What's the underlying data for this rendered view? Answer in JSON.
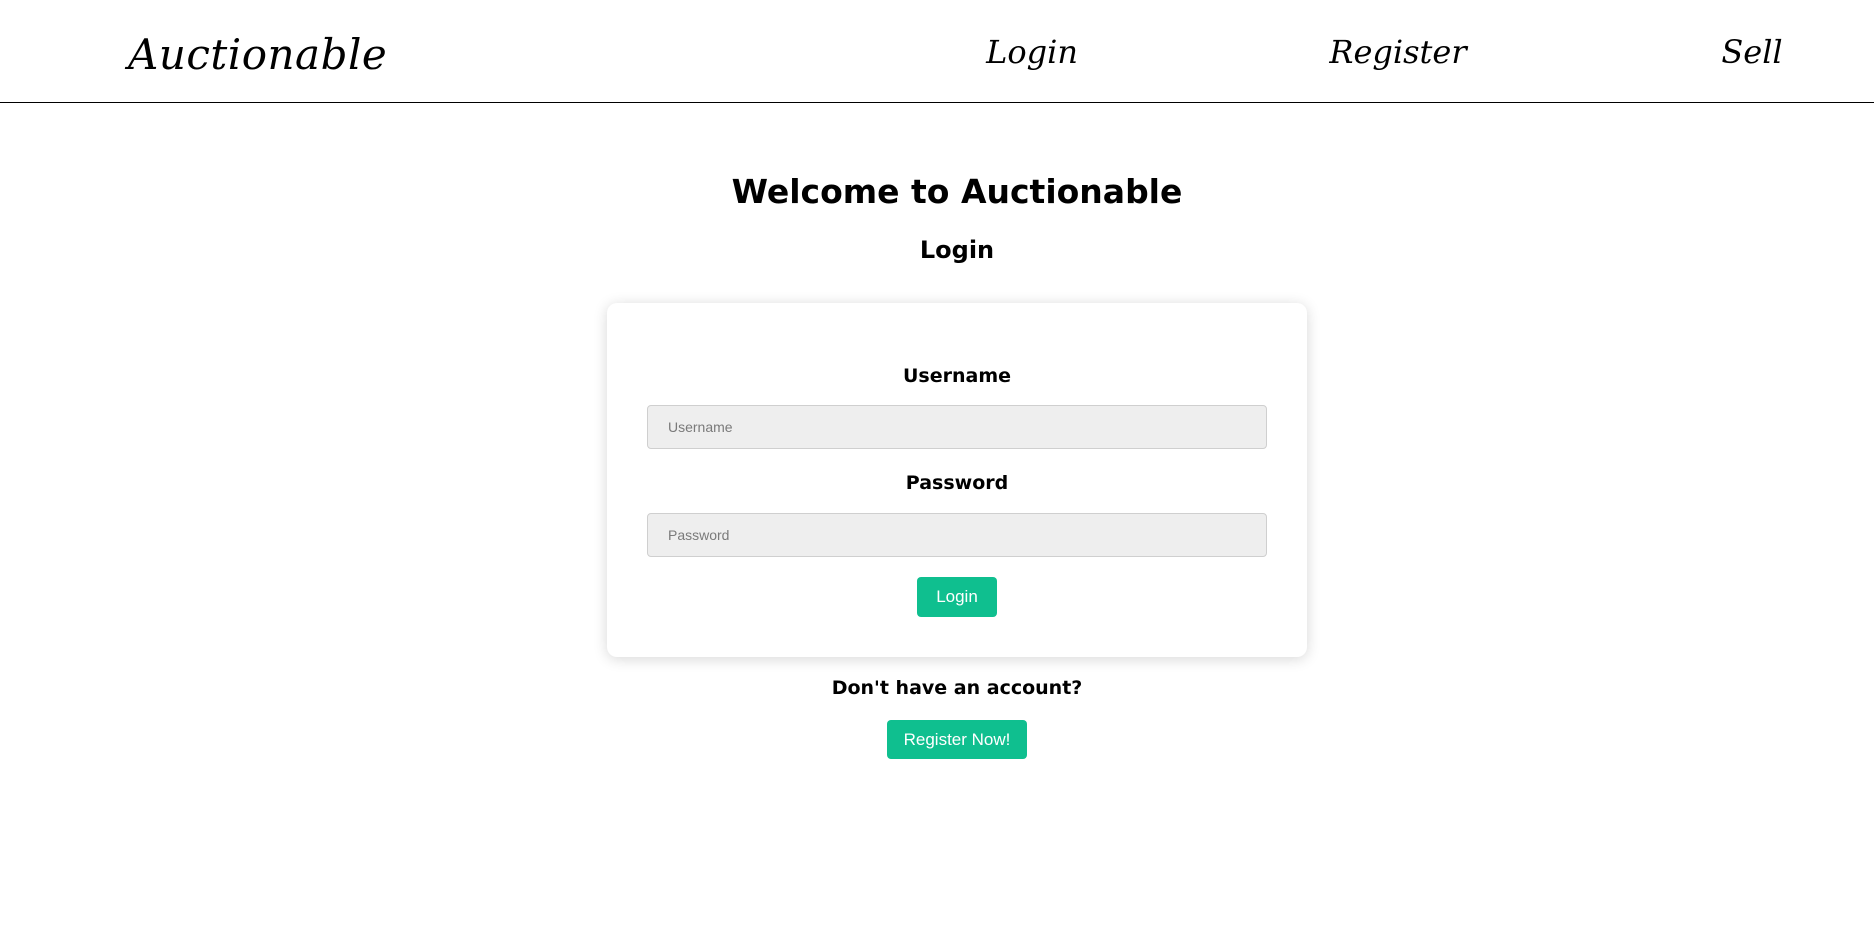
{
  "navbar": {
    "brand": "Auctionable",
    "links": {
      "login": "Login",
      "register": "Register",
      "sell": "Sell"
    }
  },
  "main": {
    "title": "Welcome to Auctionable",
    "subtitle": "Login"
  },
  "form": {
    "username_label": "Username",
    "username_placeholder": "Username",
    "username_value": "",
    "password_label": "Password",
    "password_placeholder": "Password",
    "password_value": "",
    "submit_label": "Login"
  },
  "signup": {
    "prompt": "Don't have an account?",
    "button_label": "Register Now!"
  },
  "colors": {
    "accent": "#0fbf8f",
    "input_bg": "#eeeeee",
    "nav_border": "#000000"
  }
}
